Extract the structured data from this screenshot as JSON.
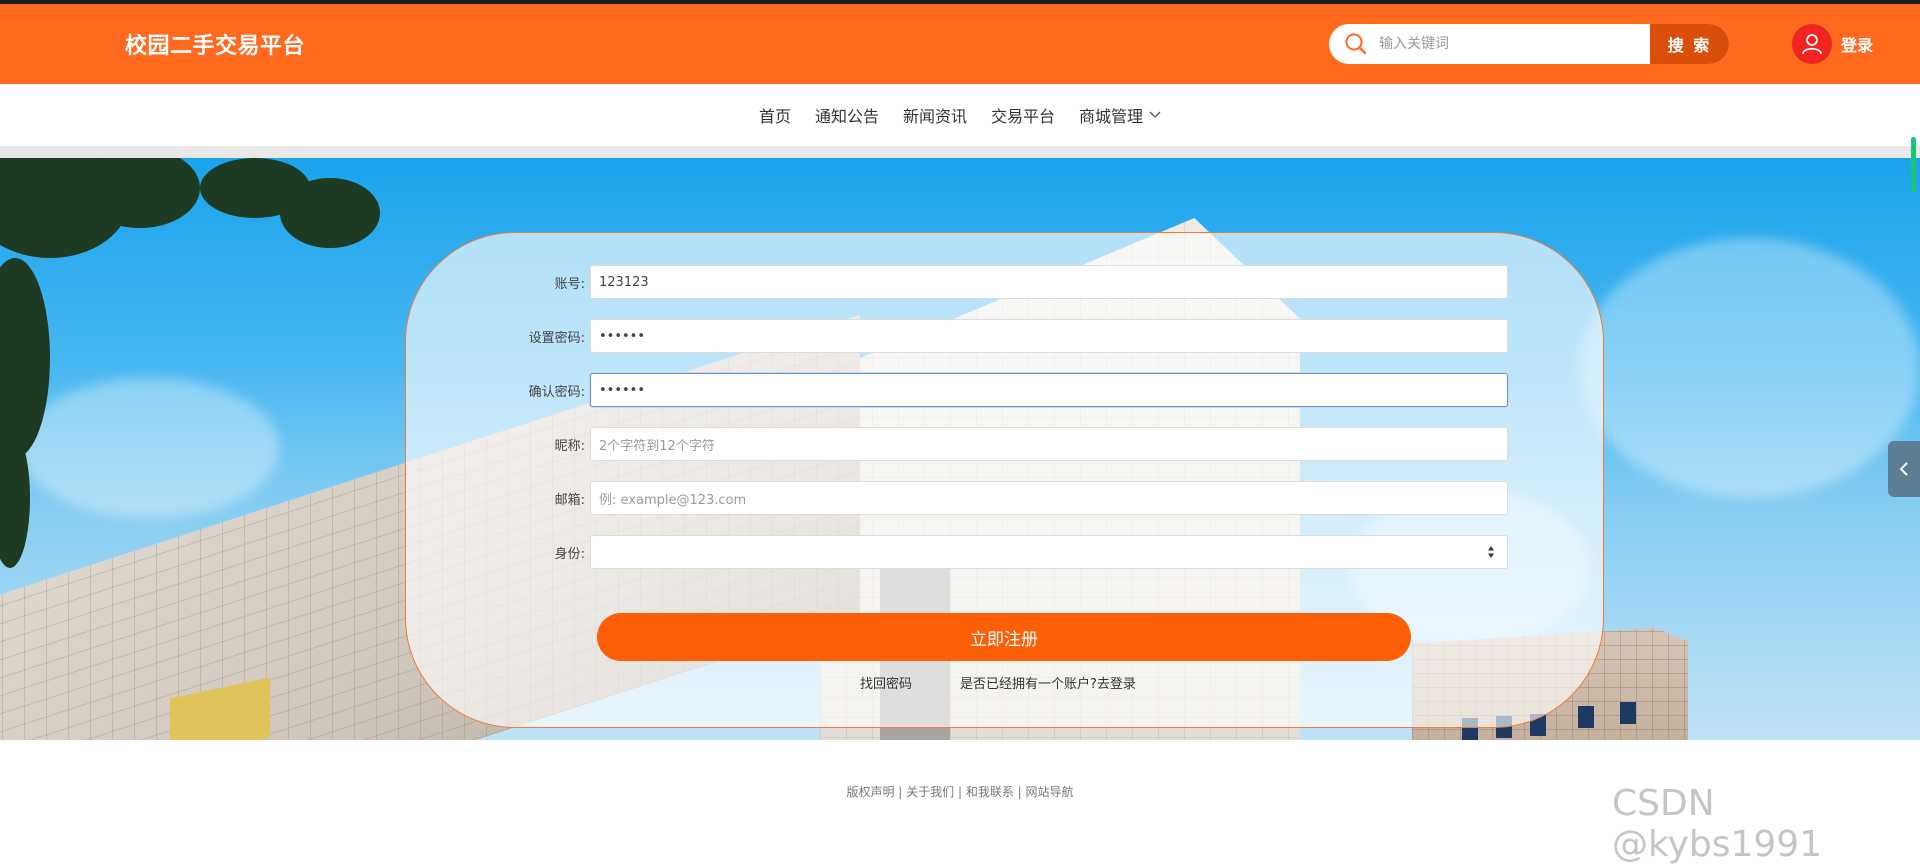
{
  "header": {
    "brand": "校园二手交易平台",
    "search_placeholder": "输入关键词",
    "search_button": "搜 索",
    "login_label": "登录"
  },
  "nav": {
    "items": [
      {
        "label": "首页"
      },
      {
        "label": "通知公告"
      },
      {
        "label": "新闻资讯"
      },
      {
        "label": "交易平台"
      },
      {
        "label": "商城管理"
      }
    ]
  },
  "form": {
    "fields": [
      {
        "label": "账号:",
        "value": "123123",
        "placeholder": ""
      },
      {
        "label": "设置密码:",
        "value": "••••••",
        "placeholder": ""
      },
      {
        "label": "确认密码:",
        "value": "••••••",
        "placeholder": ""
      },
      {
        "label": "昵称:",
        "value": "",
        "placeholder": "2个字符到12个字符"
      },
      {
        "label": "邮箱:",
        "value": "",
        "placeholder": "例: example@123.com"
      },
      {
        "label": "身份:",
        "value": "",
        "placeholder": ""
      }
    ],
    "submit_label": "立即注册",
    "forgot_password": "找回密码",
    "have_account": "是否已经拥有一个账户?去登录"
  },
  "footer": {
    "links": "版权声明 | 关于我们 | 和我联系 | 网站导航"
  },
  "watermark": "CSDN @kybs1991",
  "colors": {
    "header_bg": "#ff6a1f",
    "search_button": "#d94e08",
    "submit_button": "#fd5f08",
    "avatar_bg": "#f22323",
    "card_border": "#f07b35"
  },
  "icons": {
    "search": "search-icon",
    "user": "user-icon",
    "nav_chevron": "chevron-down-icon",
    "select": "select-arrows-icon",
    "side_tab": "chevron-left-icon"
  }
}
